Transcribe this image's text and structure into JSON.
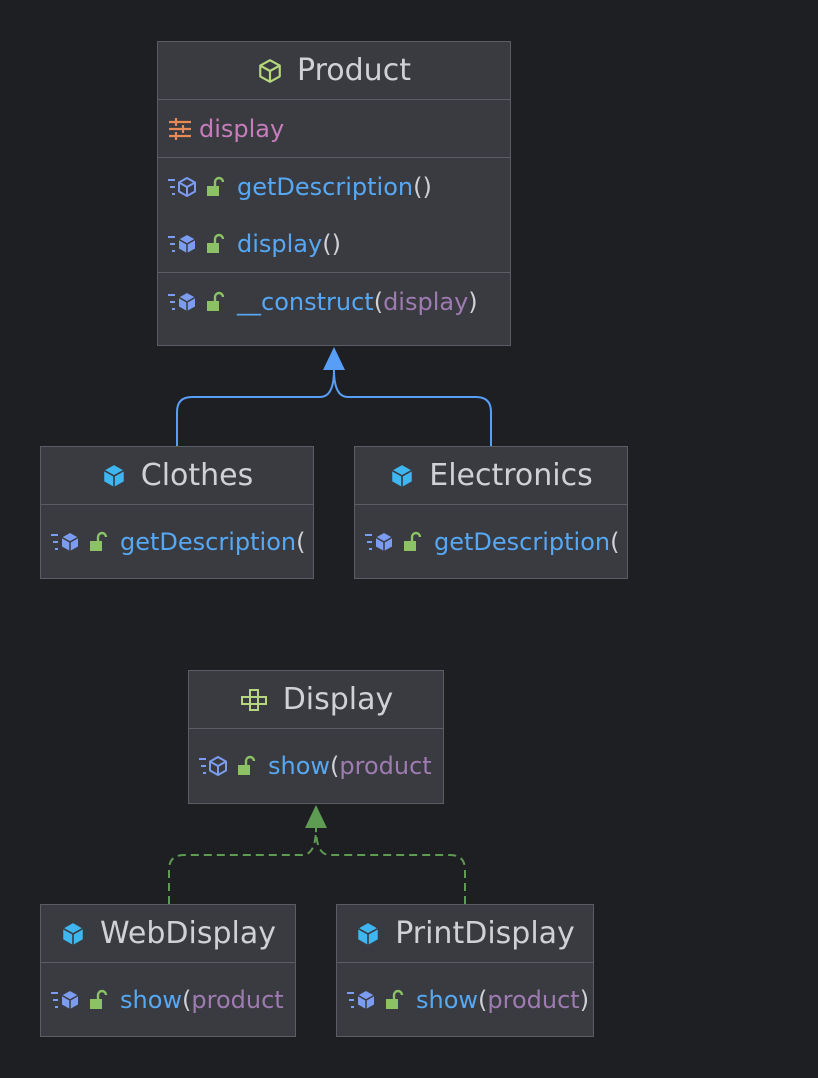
{
  "colors": {
    "background": "#1e1f22",
    "box_fill": "#393b40",
    "box_border": "#5a5d63",
    "method": "#56a8f5",
    "param": "#9e7bb0",
    "field": "#c77dbb",
    "inherit_arrow": "#589df6",
    "implement_arrow": "#5f9c53"
  },
  "classes": {
    "product": {
      "name": "Product",
      "icon": "abstract-class-icon",
      "field": "display",
      "methods": [
        {
          "name": "getDescription",
          "open": "(",
          "params": "",
          "close": ")"
        },
        {
          "name": "display",
          "open": "(",
          "params": "",
          "close": ")"
        }
      ],
      "constructor": {
        "name": "__construct",
        "open": "(",
        "params": "display",
        "close": ")"
      }
    },
    "clothes": {
      "name": "Clothes",
      "icon": "class-icon",
      "methods": [
        {
          "name": "getDescription",
          "open": "(",
          "params": "",
          "close": ""
        }
      ]
    },
    "electronics": {
      "name": "Electronics",
      "icon": "class-icon",
      "methods": [
        {
          "name": "getDescription",
          "open": "(",
          "params": "",
          "close": ""
        }
      ]
    },
    "display": {
      "name": "Display",
      "icon": "interface-icon",
      "methods": [
        {
          "name": "show",
          "open": "(",
          "params": "product",
          "close": ""
        }
      ]
    },
    "webdisplay": {
      "name": "WebDisplay",
      "icon": "class-icon",
      "methods": [
        {
          "name": "show",
          "open": "(",
          "params": "product",
          "close": ""
        }
      ]
    },
    "printdisplay": {
      "name": "PrintDisplay",
      "icon": "class-icon",
      "methods": [
        {
          "name": "show",
          "open": "(",
          "params": "product",
          "close": ")"
        }
      ]
    }
  }
}
